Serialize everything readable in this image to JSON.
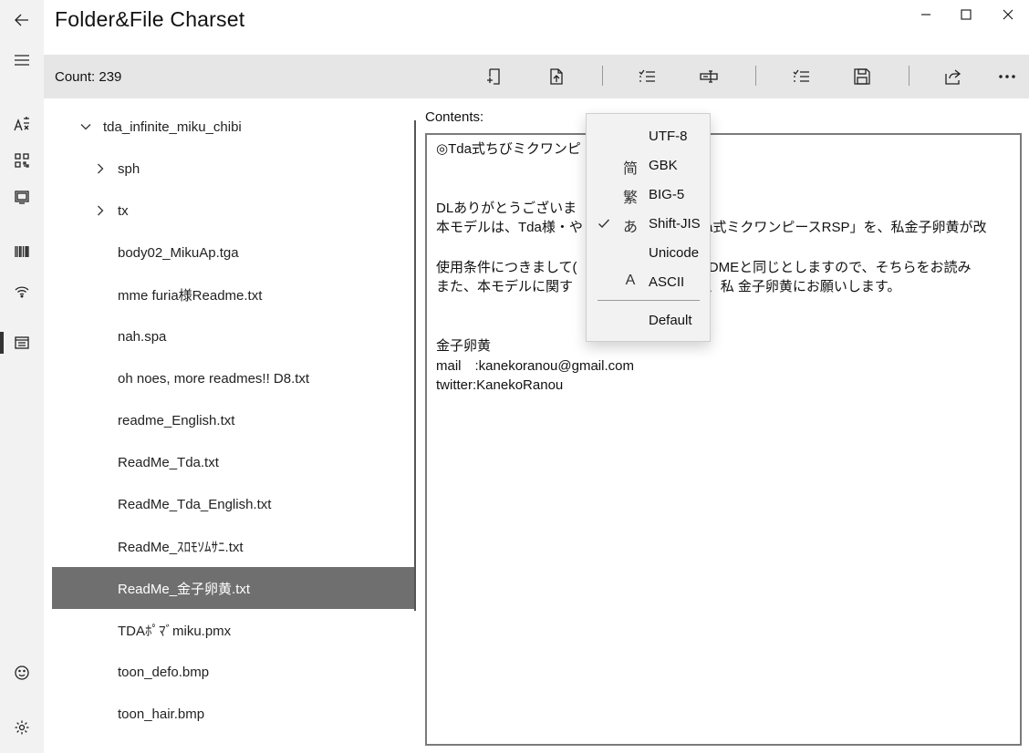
{
  "window": {
    "title": "Folder&File Charset"
  },
  "rail": {
    "icons": [
      "back-arrow-icon",
      "hamburger-icon",
      "font-charset-icon",
      "qr-code-icon",
      "media-icon",
      "barcode-icon",
      "wifi-icon",
      "folder-list-icon",
      "smiley-icon",
      "settings-icon"
    ]
  },
  "toolbar": {
    "count": "Count: 239"
  },
  "tree": {
    "items": [
      {
        "label": "tda_infinite_miku_chibi",
        "level": 0,
        "chevron": "down"
      },
      {
        "label": "sph",
        "level": 1,
        "chevron": "right"
      },
      {
        "label": "tx",
        "level": 1,
        "chevron": "right"
      },
      {
        "label": "body02_MikuAp.tga",
        "level": 1,
        "chevron": ""
      },
      {
        "label": "mme furia様Readme.txt",
        "level": 1,
        "chevron": ""
      },
      {
        "label": "nah.spa",
        "level": 1,
        "chevron": ""
      },
      {
        "label": "oh noes, more readmes!! D8.txt",
        "level": 1,
        "chevron": ""
      },
      {
        "label": "readme_English.txt",
        "level": 1,
        "chevron": ""
      },
      {
        "label": "ReadMe_Tda.txt",
        "level": 1,
        "chevron": ""
      },
      {
        "label": "ReadMe_Tda_English.txt",
        "level": 1,
        "chevron": ""
      },
      {
        "label": "ReadMe_ｽﾛﾓｿﾑｻﾆ.txt",
        "level": 1,
        "chevron": ""
      },
      {
        "label": "ReadMe_金子卵黄.txt",
        "level": 1,
        "chevron": "",
        "selected": true
      },
      {
        "label": "TDAﾎﾟﾏﾞmiku.pmx",
        "level": 1,
        "chevron": ""
      },
      {
        "label": "toon_defo.bmp",
        "level": 1,
        "chevron": ""
      },
      {
        "label": "toon_hair.bmp",
        "level": 1,
        "chevron": ""
      }
    ]
  },
  "contents": {
    "label": "Contents:",
    "lines": [
      "◎Tda式ちびミクワンピ",
      "",
      "",
      "DLありがとうございま",
      "本モデルは、Tda様・や                            Tda式ミクワンピースRSP」を、私金子卵黄が改",
      "",
      "使用条件につきまして(                          ·READMEと同じとしますので、そちらをお読み",
      "また、本モデルに関す                            等は、私 金子卵黄にお願いします。",
      "",
      "",
      "金子卵黄",
      "mail　:kanekoranou@gmail.com",
      "twitter:KanekoRanou"
    ]
  },
  "charset_menu": {
    "items": [
      {
        "label": "UTF-8",
        "glyph": "",
        "checked": false
      },
      {
        "label": "GBK",
        "glyph": "简",
        "checked": false
      },
      {
        "label": "BIG-5",
        "glyph": "繁",
        "checked": false
      },
      {
        "label": "Shift-JIS",
        "glyph": "あ",
        "checked": true
      },
      {
        "label": "Unicode",
        "glyph": "",
        "checked": false
      },
      {
        "label": "ASCII",
        "glyph": "A",
        "checked": false
      }
    ],
    "default_label": "Default"
  }
}
